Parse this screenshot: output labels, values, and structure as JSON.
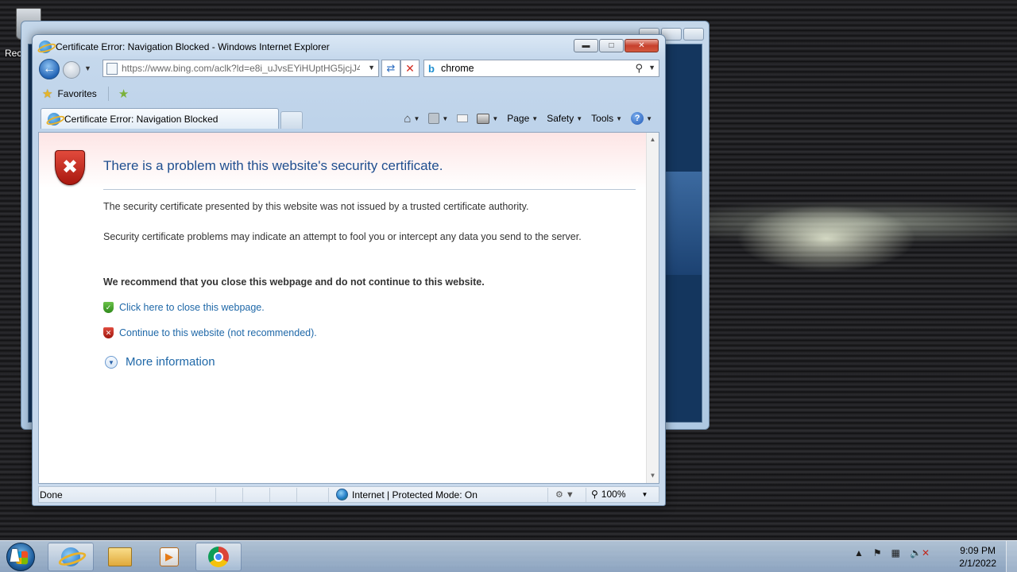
{
  "desktop": {
    "recycle_bin_label": "Rec"
  },
  "window": {
    "title": "Certificate Error: Navigation Blocked - Windows Internet Explorer"
  },
  "nav": {
    "url": "https://www.bing.com/aclk?ld=e8i_uJvsEYiHUptHG5jcjJ4",
    "search_query": "chrome"
  },
  "favorites": {
    "label": "Favorites"
  },
  "tab": {
    "title": "Certificate Error: Navigation Blocked"
  },
  "commandbar": {
    "page": "Page",
    "safety": "Safety",
    "tools": "Tools"
  },
  "content": {
    "heading": "There is a problem with this website's security certificate.",
    "p1": "The security certificate presented by this website was not issued by a trusted certificate authority.",
    "p2": "Security certificate problems may indicate an attempt to fool you or intercept any data you send to the server.",
    "recommend": "We recommend that you close this webpage and do not continue to this website.",
    "close_link": "Click here to close this webpage.",
    "continue_link": "Continue to this website (not recommended).",
    "more_info": "More information"
  },
  "status": {
    "done": "Done",
    "zone": "Internet | Protected Mode: On",
    "zoom": "100%"
  },
  "taskbar": {
    "time": "9:09 PM",
    "date": "2/1/2022"
  },
  "colors": {
    "link": "#1f68a8",
    "heading": "#1f4e8f",
    "error_red": "#c8281c"
  }
}
